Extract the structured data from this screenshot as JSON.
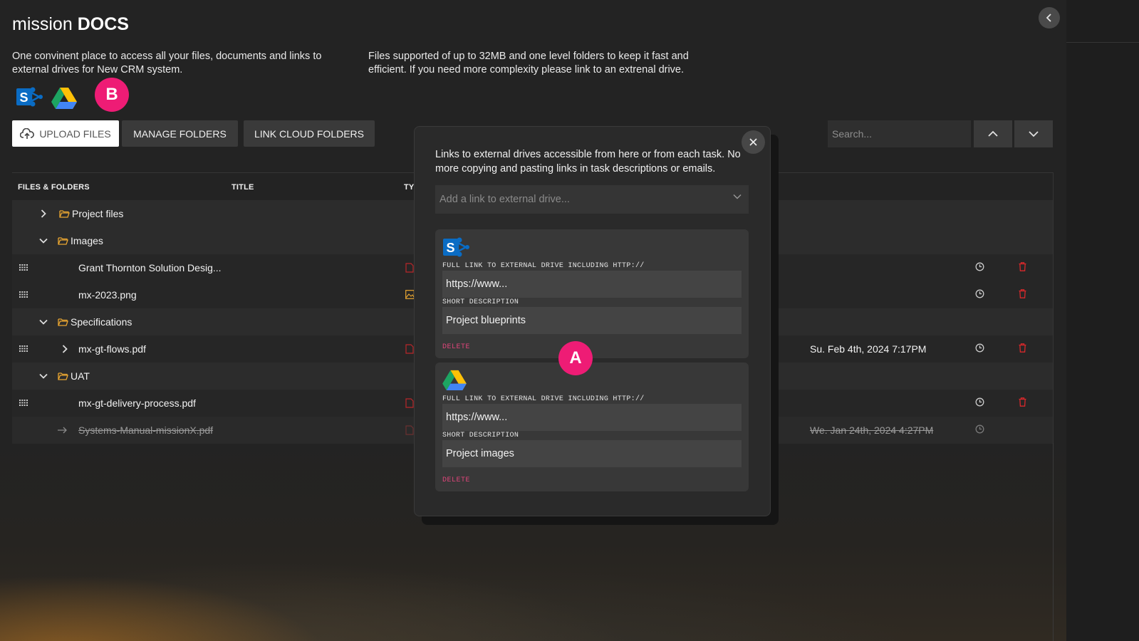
{
  "app": {
    "title_light": "mission",
    "title_bold": "DOCS",
    "description_left": "One convinent place to access all your files, documents and links to external drives for New CRM system.",
    "description_right": "Files supported of up to 32MB and one level folders to keep it fast and efficient. If you need more complexity please link to an extrenal drive."
  },
  "markers": {
    "a": "A",
    "b": "B"
  },
  "toolbar": {
    "upload_label": "UPLOAD FILES",
    "manage_label": "MANAGE FOLDERS",
    "link_label": "LINK CLOUD FOLDERS",
    "search_placeholder": "Search..."
  },
  "table": {
    "headers": {
      "files": "FILES & FOLDERS",
      "title": "TITLE",
      "type": "TY"
    },
    "rows": [
      {
        "kind": "folder",
        "name": "Project files",
        "expanded": false
      },
      {
        "kind": "folder",
        "name": "Images",
        "expanded": true
      },
      {
        "kind": "file",
        "name": "Grant Thornton Solution Desig...",
        "filetype": "pdf"
      },
      {
        "kind": "file",
        "name": "mx-2023.png",
        "filetype": "image"
      },
      {
        "kind": "folder",
        "name": "Specifications",
        "expanded": true
      },
      {
        "kind": "file",
        "name": "mx-gt-flows.pdf",
        "filetype": "pdf",
        "partial": "n",
        "date": "Su. Feb 4th, 2024 7:17PM"
      },
      {
        "kind": "folder",
        "name": "UAT",
        "expanded": true
      },
      {
        "kind": "file",
        "name": "mx-gt-delivery-process.pdf",
        "filetype": "pdf"
      },
      {
        "kind": "deleted",
        "name": "Systems-Manual-missionX.pdf",
        "filetype": "pdf",
        "partial": "e",
        "date": "We. Jan 24th, 2024 4:27PM"
      }
    ]
  },
  "modal": {
    "intro": "Links to external drives accessible from here or from each task. No more copying and pasting links in task descriptions or emails.",
    "select_placeholder": "Add a link to external drive...",
    "cards": [
      {
        "service": "sharepoint",
        "link_label": "FULL LINK TO EXTERNAL DRIVE INCLUDING HTTP://",
        "link_value": "https://www...",
        "desc_label": "SHORT DESCRIPTION",
        "desc_value": "Project blueprints",
        "delete_label": "DELETE"
      },
      {
        "service": "google-drive",
        "link_label": "FULL LINK TO EXTERNAL DRIVE INCLUDING HTTP://",
        "link_value": "https://www...",
        "desc_label": "SHORT DESCRIPTION",
        "desc_value": "Project images",
        "delete_label": "DELETE"
      }
    ]
  },
  "colors": {
    "accent_pink": "#ee1c75",
    "folder_yellow": "#e8a531",
    "delete_red": "#d8282b",
    "pdf_red": "#b8272a",
    "sharepoint_blue": "#0a6cc4"
  }
}
